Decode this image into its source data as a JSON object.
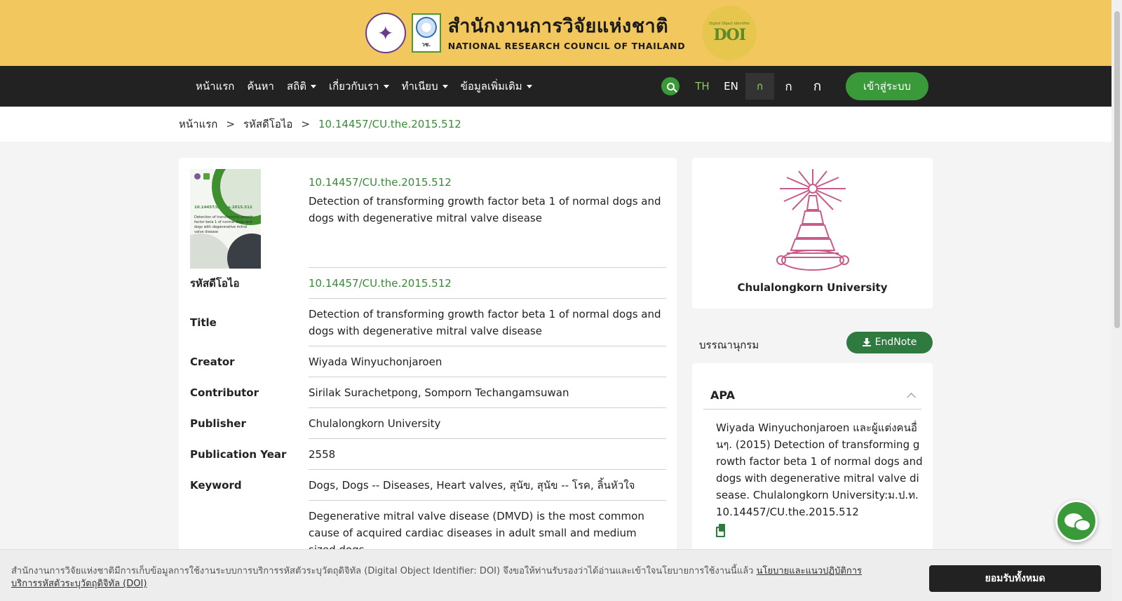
{
  "header": {
    "org_th": "สำนักงานการวิจัยแห่งชาติ",
    "org_en": "NATIONAL RESEARCH COUNCIL OF THAILAND",
    "nrct_abbr": "วช.",
    "nrct_en": "NRCT",
    "doi_badge_small": "Digital Object Identifier",
    "doi_badge_big": "DOI"
  },
  "nav": {
    "items": [
      {
        "label": "หน้าแรก",
        "dropdown": false
      },
      {
        "label": "ค้นหา",
        "dropdown": false
      },
      {
        "label": "สถิติ",
        "dropdown": true
      },
      {
        "label": "เกี่ยวกับเรา",
        "dropdown": true
      },
      {
        "label": "ทำเนียบ",
        "dropdown": true
      },
      {
        "label": "ข้อมูลเพิ่มเติม",
        "dropdown": true
      }
    ],
    "lang_th": "TH",
    "lang_en": "EN",
    "font_small": "ก",
    "font_medium": "ก",
    "font_large": "ก",
    "login": "เข้าสู่ระบบ",
    "accent": "#3a9a3a"
  },
  "breadcrumb": {
    "home": "หน้าแรก",
    "section": "รหัสดีโอไอ",
    "current": "10.14457/CU.the.2015.512",
    "sep": ">"
  },
  "record": {
    "cover_doi": "10.14457/CU.the.2015.512",
    "cover_title": "Detection of transforming growth factor beta 1 of normal dogs and dogs with degenerative mitral valve disease",
    "doi": "10.14457/CU.the.2015.512",
    "title": "Detection of transforming growth factor beta 1 of normal dogs and dogs with degenerative mitral valve disease",
    "fields": [
      {
        "label": "รหัสดีโอไอ",
        "value": "10.14457/CU.the.2015.512",
        "link": true
      },
      {
        "label": "Title",
        "value": "Detection of transforming growth factor beta 1 of normal dogs and dogs with degenerative mitral valve disease",
        "link": false
      },
      {
        "label": "Creator",
        "value": "Wiyada Winyuchonjaroen",
        "link": false
      },
      {
        "label": "Contributor",
        "value": "Sirilak Surachetpong, Somporn Techangamsuwan",
        "link": false
      },
      {
        "label": "Publisher",
        "value": "Chulalongkorn University",
        "link": false
      },
      {
        "label": "Publication Year",
        "value": "2558",
        "link": false
      },
      {
        "label": "Keyword",
        "value": "Dogs, Dogs -- Diseases, Heart valves, สุนัข, สุนัข -- โรค, ลิ้นหัวใจ",
        "link": false
      },
      {
        "label": "",
        "value": "Degenerative mitral valve disease (DMVD) is the most common cause of acquired cardiac diseases in adult small and medium sized dogs.",
        "link": false
      }
    ]
  },
  "sidebar": {
    "university": "Chulalongkorn University",
    "biblio_title": "บรรณานุกรม",
    "endnote": "EndNote",
    "apa_label": "APA",
    "apa_text": "Wiyada Winyuchonjaroen และผู้แต่งคนอื่นๆ. (2015) Detection of transforming growth factor beta 1 of normal dogs and dogs with degenerative mitral valve disease. Chulalongkorn University:ม.ป.ท. 10.14457/CU.the.2015.512"
  },
  "cookie": {
    "text": "สำนักงานการวิจัยแห่งชาติมีการเก็บข้อมูลการใช้งานระบบการบริการรหัสตัวระบุวัตถุดิจิทัล (Digital Object Identifier: DOI) จึงขอให้ท่านรับรองว่าได้อ่านและเข้าใจนโยบายการใช้งานนี้แล้ว",
    "policy_link": "นโยบายและแนวปฏิบัติการบริการรหัสตัวระบุวัตถุดิจิทัล (DOI)",
    "accept": "ยอมรับทั้งหมด"
  }
}
